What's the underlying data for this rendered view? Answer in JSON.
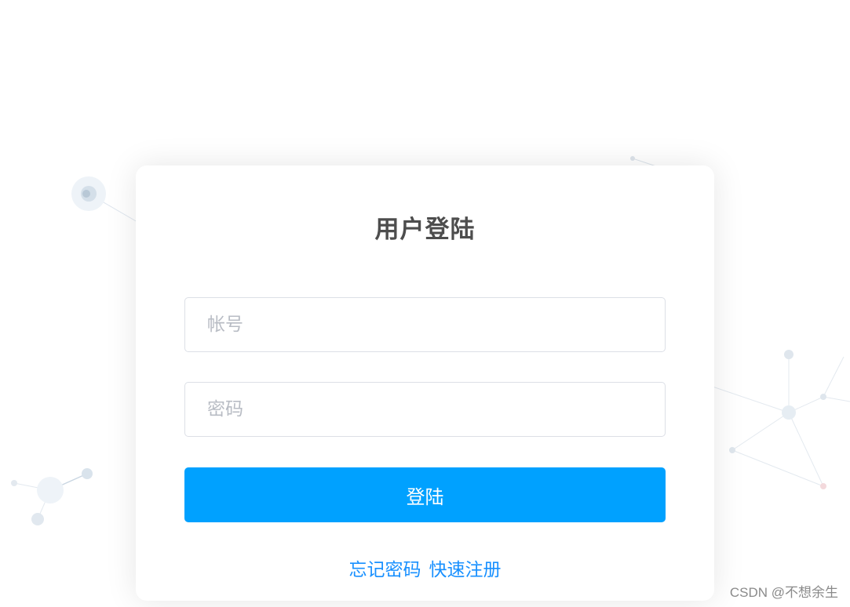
{
  "login": {
    "title": "用户登陆",
    "account_placeholder": "帐号",
    "password_placeholder": "密码",
    "submit_label": "登陆",
    "forgot_label": "忘记密码",
    "register_label": "快速注册"
  },
  "watermark": "CSDN @不想余生",
  "colors": {
    "primary": "#00a1ff",
    "link": "#1890ff",
    "title": "#4d4d4d",
    "placeholder": "#b8bcc4"
  }
}
